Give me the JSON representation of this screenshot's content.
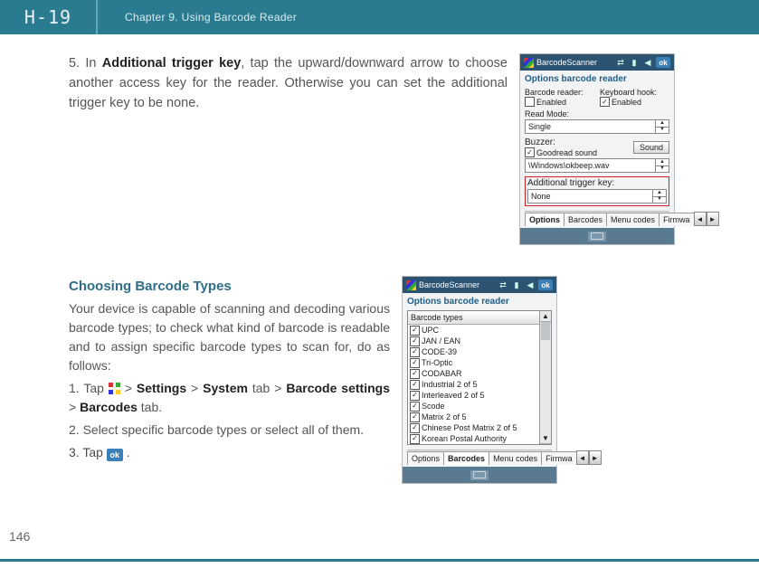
{
  "header": {
    "logo": "H-19",
    "chapter": "Chapter 9. Using Barcode Reader"
  },
  "page_number": "146",
  "step5": {
    "num": "5.",
    "lead": "In ",
    "key": "Additional trigger key",
    "tail": ", tap the upward/downward arrow to choose another access key for the reader. Otherwise you can set the additional trigger key to be none."
  },
  "screenshot1": {
    "title": "BarcodeScanner",
    "ok": "ok",
    "caption": "Options barcode reader",
    "reader_label": "Barcode reader:",
    "reader_chk": "Enabled",
    "hook_label": "Keyboard hook:",
    "hook_chk": "Enabled",
    "readmode_label": "Read Mode:",
    "readmode_value": "Single",
    "buzzer_label": "Buzzer:",
    "buzzer_chk": "Goodread sound",
    "sound_btn": "Sound",
    "sound_path": "\\Windows\\okbeep.wav",
    "atk_label": "Additional trigger key:",
    "atk_value": "None",
    "tabs": [
      "Options",
      "Barcodes",
      "Menu codes",
      "Firmwa"
    ]
  },
  "section2": {
    "heading": "Choosing Barcode Types",
    "para1": "Your device is capable of scanning and decoding various barcode types; to check what kind of barcode is readable and to assign specific barcode types to scan for, do as follows:",
    "s1a": "1. Tap ",
    "s1b": " > ",
    "s1_settings": "Settings",
    "s1_system": "System",
    "s1_tab": " tab > ",
    "s1_bcs": "Barcode settings",
    "s1_barcodes": "Barcodes",
    "s1_tab2": " tab.",
    "s2": "2. Select specific barcode types or select all of them.",
    "s3a": "3. Tap ",
    "s3b": " ."
  },
  "screenshot2": {
    "title": "BarcodeScanner",
    "ok": "ok",
    "caption": "Options barcode reader",
    "list_head": "Barcode types",
    "items": [
      "UPC",
      "JAN / EAN",
      "CODE-39",
      "Tri-Optic",
      "CODABAR",
      "Industrial 2 of 5",
      "Interleaved 2 of 5",
      "Scode",
      "Matrix 2 of 5",
      "Chinese Post Matrix 2 of 5",
      "Korean Postal Authority"
    ],
    "tabs": [
      "Options",
      "Barcodes",
      "Menu codes",
      "Firmwa"
    ]
  }
}
